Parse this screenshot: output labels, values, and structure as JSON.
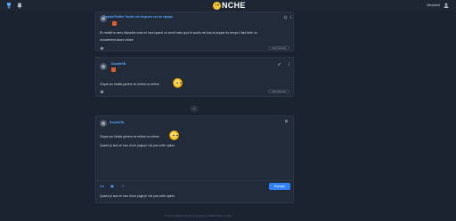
{
  "topbar": {
    "logo_text": "NCHE",
    "username": "Wesleini"
  },
  "posts": [
    {
      "author": "Double/Twitter Tackle est toujours sur un équipé",
      "text_lines": [
        "En réalité le sens cliquable mais en haut quand on scroll mais quoi le souris est bas la plupart du temps il faut faire un",
        "mouvement assez chiant"
      ],
      "reply_label": "Citer/répondre"
    },
    {
      "author": "DoubleSN",
      "text": "Clique sur blabla génère ce enfant ou même",
      "reply_label": "Citer/répondre"
    }
  ],
  "divider_label": "≡",
  "editor": {
    "author": "DoubleSN",
    "line1": "Clique sur blabla génère ce enfant ou même",
    "line2": "Quand je suis en bas d'une page je n'ai pas cette option",
    "tools": [
      "Aa",
      "▣",
      "☺"
    ],
    "send_label": "Envoyer",
    "preview": "Quand je suis en bas d'une page je n'ai pas cette option"
  },
  "footer": "© Onche   Règles   Mentions légales   Confidentialité   Contact"
}
